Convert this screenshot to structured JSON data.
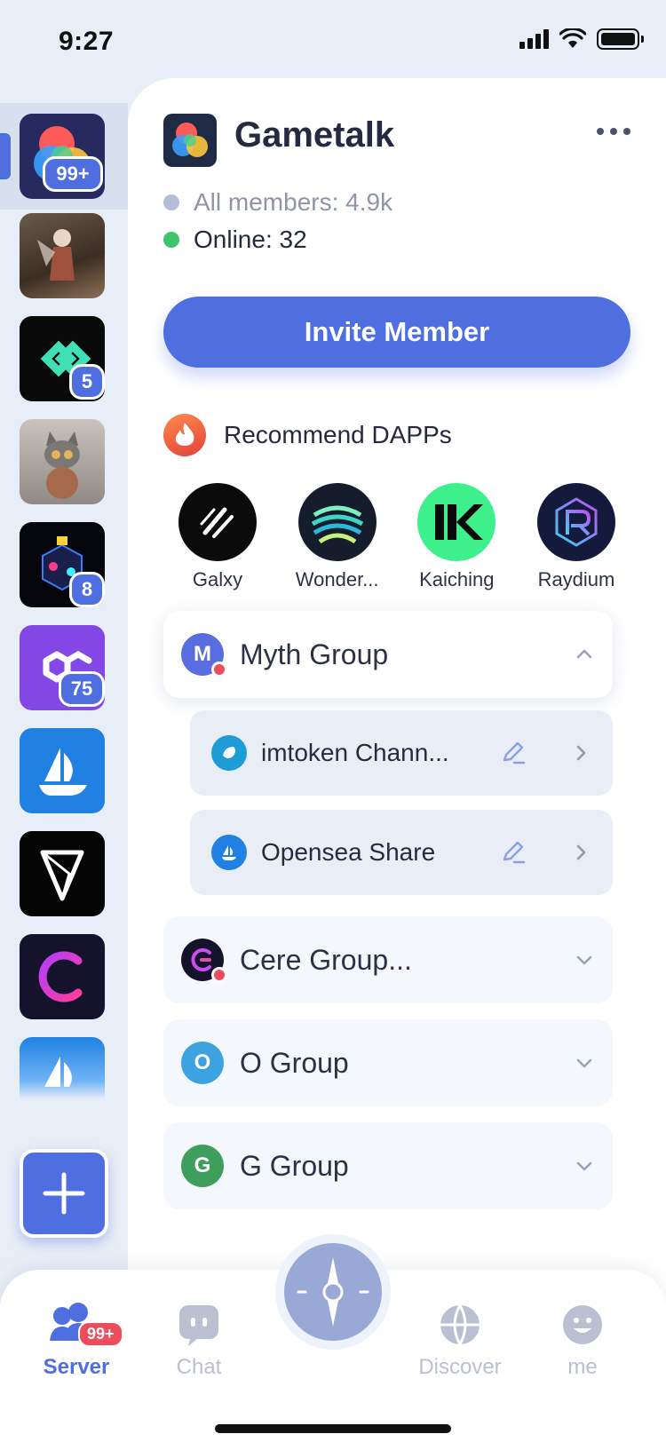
{
  "status_bar": {
    "time": "9:27"
  },
  "server_rail": {
    "servers": [
      {
        "name": "gametalk-server",
        "badge": "99+"
      },
      {
        "name": "fantasy-warrior-server",
        "badge": ""
      },
      {
        "name": "diamond-server",
        "badge": "5"
      },
      {
        "name": "cat-server",
        "badge": ""
      },
      {
        "name": "neon-cube-server",
        "badge": "8"
      },
      {
        "name": "polygon-server",
        "badge": "75"
      },
      {
        "name": "opensea-server",
        "badge": ""
      },
      {
        "name": "v-server",
        "badge": ""
      },
      {
        "name": "cere-server",
        "badge": ""
      },
      {
        "name": "opensea-server-2",
        "badge": ""
      }
    ]
  },
  "guild": {
    "title": "Gametalk",
    "all_members": "All members: 4.9k",
    "online": "Online: 32",
    "invite_label": "Invite Member"
  },
  "dapps": {
    "title": "Recommend DAPPs",
    "items": [
      {
        "label": "Galxy",
        "icon": "galxy-icon"
      },
      {
        "label": "Wonder...",
        "icon": "wonder-icon"
      },
      {
        "label": "Kaiching",
        "icon": "kaiching-icon"
      },
      {
        "label": "Raydium",
        "icon": "raydium-icon"
      }
    ]
  },
  "groups": [
    {
      "name": "Myth Group",
      "avatar_letter": "M",
      "expanded": true,
      "channels": [
        {
          "name": "imtoken Chann..."
        },
        {
          "name": "Opensea Share"
        }
      ]
    },
    {
      "name": "Cere Group...",
      "avatar_letter": "",
      "expanded": false
    },
    {
      "name": "O Group",
      "avatar_letter": "O",
      "expanded": false
    },
    {
      "name": "G Group",
      "avatar_letter": "G",
      "expanded": false
    }
  ],
  "bottom_nav": {
    "server": {
      "label": "Server",
      "badge": "99+"
    },
    "chat": {
      "label": "Chat"
    },
    "discover": {
      "label": "Discover"
    },
    "me": {
      "label": "me"
    }
  },
  "colors": {
    "accent": "#4f6ee0",
    "online": "#3ec46d",
    "offline": "#b3bdd6",
    "alert": "#ec4c5c"
  }
}
